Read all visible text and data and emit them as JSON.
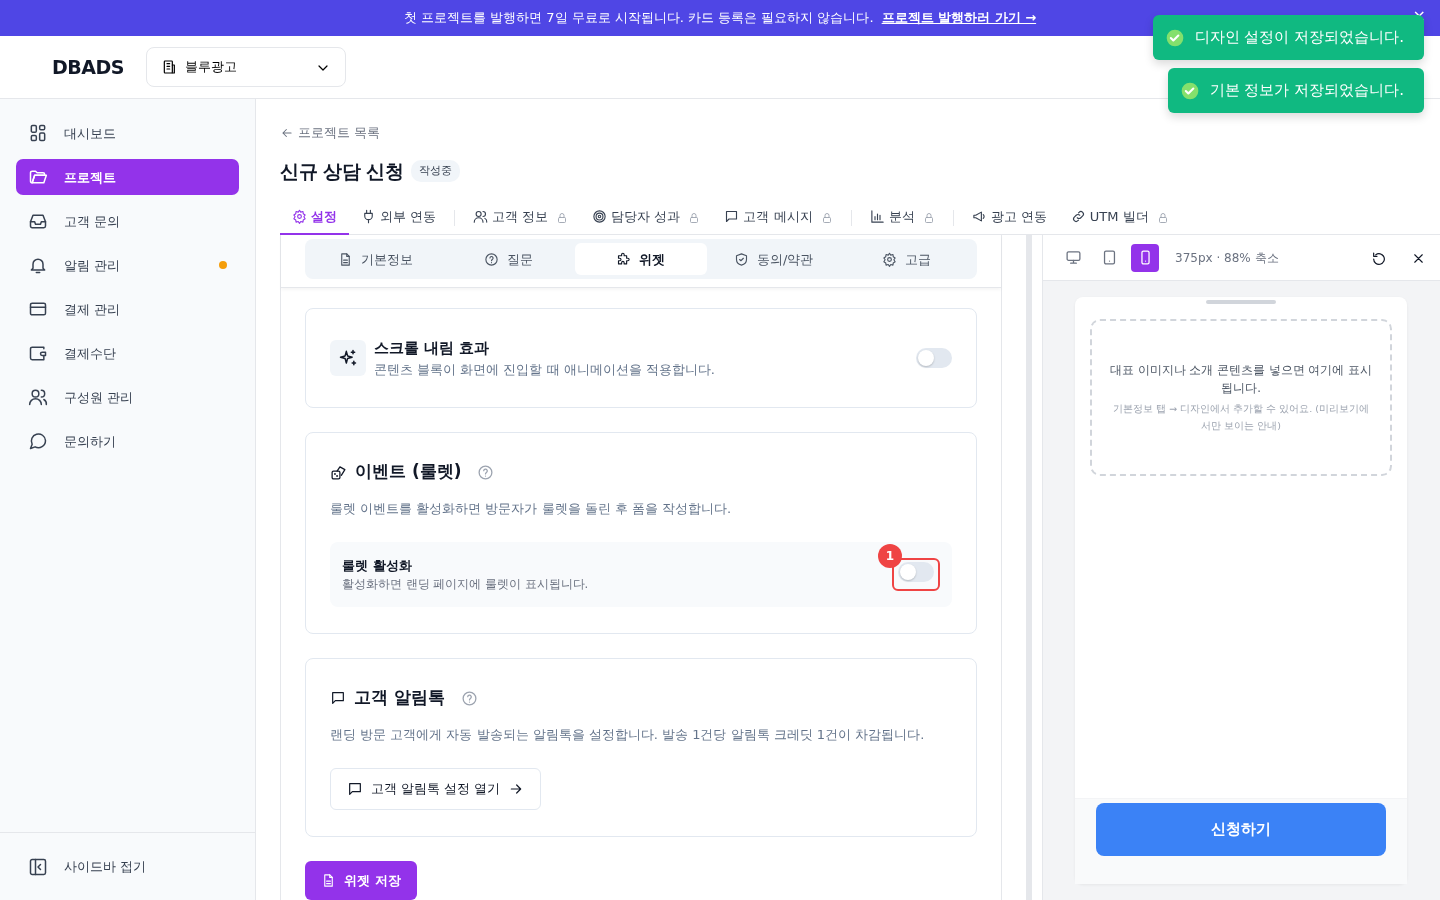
{
  "banner": {
    "text": "첫 프로젝트를 발행하면 7일 무료로 시작됩니다. 카드 등록은 필요하지 않습니다.",
    "link": "프로젝트 발행하러 가기 →",
    "close": "×"
  },
  "header": {
    "logo": "DBADS",
    "workspace": "블루광고"
  },
  "toasts": [
    {
      "text": "디자인 설정이 저장되었습니다."
    },
    {
      "text": "기본 정보가 저장되었습니다."
    }
  ],
  "sidebar": {
    "items": [
      {
        "label": "대시보드",
        "selected": false
      },
      {
        "label": "프로젝트",
        "selected": true
      },
      {
        "label": "고객 문의",
        "selected": false
      },
      {
        "label": "알림 관리",
        "selected": false,
        "color": "#f59e0b"
      },
      {
        "label": "결제 관리",
        "selected": false
      },
      {
        "label": "결제수단",
        "selected": false
      },
      {
        "label": "구성원 관리",
        "selected": false
      },
      {
        "label": "문의하기",
        "selected": false
      }
    ],
    "collapse": "사이드바 접기"
  },
  "back_link": "프로젝트 목록",
  "title": "신규 상담 신청",
  "status": "작성중",
  "tabs": [
    {
      "label": "설정",
      "selected": true,
      "locked": false,
      "divider_after": false
    },
    {
      "label": "외부 연동",
      "selected": false,
      "locked": false,
      "divider_after": true
    },
    {
      "label": "고객 정보",
      "selected": false,
      "locked": true,
      "divider_after": false
    },
    {
      "label": "담당자 성과",
      "selected": false,
      "locked": true,
      "divider_after": false
    },
    {
      "label": "고객 메시지",
      "selected": false,
      "locked": true,
      "divider_after": true
    },
    {
      "label": "분석",
      "selected": false,
      "locked": true,
      "divider_after": true
    },
    {
      "label": "광고 연동",
      "selected": false,
      "locked": false,
      "divider_after": false
    },
    {
      "label": "UTM 빌더",
      "selected": false,
      "locked": true,
      "divider_after": false
    }
  ],
  "subtabs": [
    {
      "label": "기본정보",
      "selected": false
    },
    {
      "label": "질문",
      "selected": false
    },
    {
      "label": "위젯",
      "selected": true
    },
    {
      "label": "동의/약관",
      "selected": false
    },
    {
      "label": "고급",
      "selected": false
    }
  ],
  "scroll_effect": {
    "title": "스크롤 내림 효과",
    "description": "콘텐츠 블록이 화면에 진입할 때 애니메이션을 적용합니다.",
    "on": false
  },
  "roulette": {
    "title": "이벤트 (룰렛)",
    "description": "룰렛 이벤트를 활성화하면 방문자가 룰렛을 돌린 후 폼을 작성합니다.",
    "toggle_label": "룰렛 활성화",
    "toggle_description": "활성화하면 랜딩 페이지에 룰렛이 표시됩니다.",
    "on": false,
    "marker": "1"
  },
  "alimtalk": {
    "title": "고객 알림톡",
    "description": "랜딩 방문 고객에게 자동 발송되는 알림톡을 설정합니다. 발송 1건당 알림톡 크레딧 1건이 차감됩니다.",
    "button": "고객 알림톡 설정 열기"
  },
  "save_button": "위젯 저장",
  "preview": {
    "devices": [
      {
        "selected": false
      },
      {
        "selected": false
      },
      {
        "selected": true
      }
    ],
    "size_label": "375px · 88% 축소",
    "placeholder_title": "대표 이미지나 소개 콘텐츠를 넣으면 여기에 표시됩니다.",
    "placeholder_hint": "기본정보 탭 → 디자인에서 추가할 수 있어요. (미리보기에서만 보이는 안내)",
    "cta": "신청하기"
  }
}
